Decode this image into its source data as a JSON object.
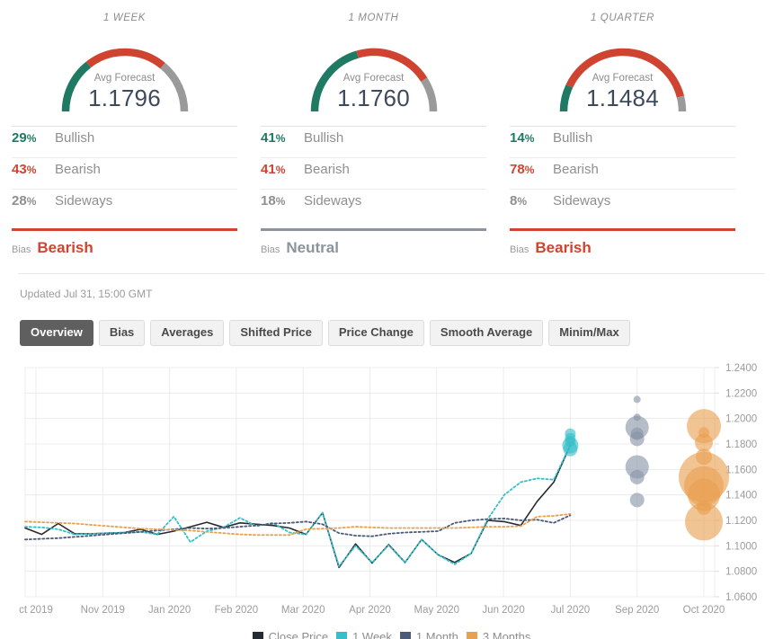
{
  "panels": [
    {
      "title": "1 WEEK",
      "caption": "Avg Forecast",
      "value": "1.1796",
      "stats": [
        {
          "pct": "29",
          "unit": "%",
          "label": "Bullish"
        },
        {
          "pct": "43",
          "unit": "%",
          "label": "Bearish"
        },
        {
          "pct": "28",
          "unit": "%",
          "label": "Sideways"
        }
      ],
      "bias_key": "Bias",
      "bias_value": "Bearish",
      "bias_kind": "bearish",
      "gauge": {
        "bullish": 29,
        "bearish": 43,
        "sideways": 28
      }
    },
    {
      "title": "1 MONTH",
      "caption": "Avg Forecast",
      "value": "1.1760",
      "stats": [
        {
          "pct": "41",
          "unit": "%",
          "label": "Bullish"
        },
        {
          "pct": "41",
          "unit": "%",
          "label": "Bearish"
        },
        {
          "pct": "18",
          "unit": "%",
          "label": "Sideways"
        }
      ],
      "bias_key": "Bias",
      "bias_value": "Neutral",
      "bias_kind": "neutral",
      "gauge": {
        "bullish": 41,
        "bearish": 41,
        "sideways": 18
      }
    },
    {
      "title": "1 QUARTER",
      "caption": "Avg Forecast",
      "value": "1.1484",
      "stats": [
        {
          "pct": "14",
          "unit": "%",
          "label": "Bullish"
        },
        {
          "pct": "78",
          "unit": "%",
          "label": "Bearish"
        },
        {
          "pct": "8",
          "unit": "%",
          "label": "Sideways"
        }
      ],
      "bias_key": "Bias",
      "bias_value": "Bearish",
      "bias_kind": "bearish",
      "gauge": {
        "bullish": 14,
        "bearish": 78,
        "sideways": 8
      }
    }
  ],
  "updated": "Updated Jul 31, 15:00 GMT",
  "tabs": [
    {
      "label": "Overview",
      "active": true
    },
    {
      "label": "Bias",
      "active": false
    },
    {
      "label": "Averages",
      "active": false
    },
    {
      "label": "Shifted Price",
      "active": false
    },
    {
      "label": "Price Change",
      "active": false
    },
    {
      "label": "Smooth Average",
      "active": false
    },
    {
      "label": "Minim/Max",
      "active": false
    }
  ],
  "colors": {
    "bullish": "#1f7a63",
    "bearish": "#cf4431",
    "sideways": "#9a9a9a",
    "close_price": "#262b33",
    "one_week": "#35bfc8",
    "one_month": "#4a5a78",
    "three_months": "#e8a051",
    "grid": "#ececec",
    "axis_text": "#9b9b9b"
  },
  "chart_data": {
    "type": "line",
    "title": "",
    "xlabel": "",
    "ylabel": "",
    "ylim": [
      1.06,
      1.24
    ],
    "grid": true,
    "legend_position": "bottom",
    "ytick_labels": [
      "1.2400",
      "1.2200",
      "1.2000",
      "1.1800",
      "1.1600",
      "1.1400",
      "1.1200",
      "1.1000",
      "1.0800",
      "1.0600"
    ],
    "yticks": [
      1.24,
      1.22,
      1.2,
      1.18,
      1.16,
      1.14,
      1.12,
      1.1,
      1.08,
      1.06
    ],
    "xtick_labels": [
      "ct 2019",
      "Nov 2019",
      "Jan 2020",
      "Feb 2020",
      "Mar 2020",
      "Apr 2020",
      "May 2020",
      "Jun 2020",
      "Jul 2020",
      "Sep 2020",
      "Oct 2020"
    ],
    "legend": [
      {
        "name": "Close Price",
        "color": "#262b33",
        "style": "solid"
      },
      {
        "name": "1 Week",
        "color": "#35bfc8",
        "style": "dotted"
      },
      {
        "name": "1 Month",
        "color": "#4a5a78",
        "style": "dotted"
      },
      {
        "name": "3 Months",
        "color": "#e8a051",
        "style": "dotted"
      }
    ],
    "series": [
      {
        "name": "Close Price",
        "color": "#262b33",
        "style": "solid",
        "values": [
          1.114,
          1.109,
          1.1175,
          1.1095,
          1.1095,
          1.11,
          1.1105,
          1.113,
          1.109,
          1.1115,
          1.115,
          1.1185,
          1.1145,
          1.118,
          1.117,
          1.116,
          1.114,
          1.109,
          1.126,
          1.083,
          1.1015,
          1.0865,
          1.101,
          1.087,
          1.105,
          1.093,
          1.087,
          1.094,
          1.12,
          1.119,
          1.116,
          1.135,
          1.15,
          1.179
        ]
      },
      {
        "name": "1 Week",
        "color": "#35bfc8",
        "style": "dotted",
        "values": [
          1.115,
          1.1145,
          1.113,
          1.109,
          1.1095,
          1.11,
          1.1105,
          1.111,
          1.109,
          1.123,
          1.103,
          1.1115,
          1.1145,
          1.122,
          1.1155,
          1.118,
          1.1105,
          1.109,
          1.126,
          1.084,
          1.1,
          1.087,
          1.1005,
          1.087,
          1.105,
          1.093,
          1.0855,
          1.094,
          1.121,
          1.14,
          1.15,
          1.153,
          1.152,
          1.179
        ]
      },
      {
        "name": "1 Month",
        "color": "#4a5a78",
        "style": "dotted",
        "values": [
          1.105,
          1.1055,
          1.106,
          1.107,
          1.108,
          1.109,
          1.11,
          1.111,
          1.112,
          1.113,
          1.114,
          1.1135,
          1.114,
          1.115,
          1.116,
          1.1175,
          1.118,
          1.119,
          1.117,
          1.11,
          1.108,
          1.1075,
          1.1095,
          1.1105,
          1.111,
          1.1115,
          1.118,
          1.12,
          1.121,
          1.1215,
          1.12,
          1.1205,
          1.118,
          1.124
        ]
      },
      {
        "name": "3 Months",
        "color": "#e8a051",
        "style": "dotted",
        "values": [
          1.119,
          1.1185,
          1.118,
          1.1175,
          1.1165,
          1.1155,
          1.1145,
          1.1135,
          1.113,
          1.1125,
          1.112,
          1.111,
          1.11,
          1.109,
          1.1085,
          1.1085,
          1.1085,
          1.113,
          1.1135,
          1.114,
          1.115,
          1.1145,
          1.114,
          1.114,
          1.114,
          1.114,
          1.114,
          1.1145,
          1.115,
          1.115,
          1.1155,
          1.123,
          1.1235,
          1.125
        ]
      }
    ],
    "bubbles": [
      {
        "series": "1 Week",
        "color": "#35bfc8",
        "x_label": "Jul 2020",
        "points": [
          {
            "y": 1.188,
            "r": 6
          },
          {
            "y": 1.1845,
            "r": 6
          },
          {
            "y": 1.182,
            "r": 6
          },
          {
            "y": 1.179,
            "r": 9
          },
          {
            "y": 1.176,
            "r": 8
          }
        ]
      },
      {
        "series": "1 Month",
        "color": "#8795a8",
        "x_label": "Sep 2020",
        "points": [
          {
            "y": 1.215,
            "r": 4
          },
          {
            "y": 1.201,
            "r": 4
          },
          {
            "y": 1.193,
            "r": 13
          },
          {
            "y": 1.188,
            "r": 7
          },
          {
            "y": 1.184,
            "r": 8
          },
          {
            "y": 1.162,
            "r": 13
          },
          {
            "y": 1.154,
            "r": 8
          },
          {
            "y": 1.136,
            "r": 8
          }
        ]
      },
      {
        "series": "3 Months",
        "color": "#e8a051",
        "x_label": "Oct 2020",
        "points": [
          {
            "y": 1.194,
            "r": 19
          },
          {
            "y": 1.189,
            "r": 6
          },
          {
            "y": 1.181,
            "r": 10
          },
          {
            "y": 1.17,
            "r": 9
          },
          {
            "y": 1.154,
            "r": 28
          },
          {
            "y": 1.147,
            "r": 22
          },
          {
            "y": 1.14,
            "r": 18
          },
          {
            "y": 1.13,
            "r": 8
          },
          {
            "y": 1.119,
            "r": 21
          }
        ]
      }
    ]
  }
}
